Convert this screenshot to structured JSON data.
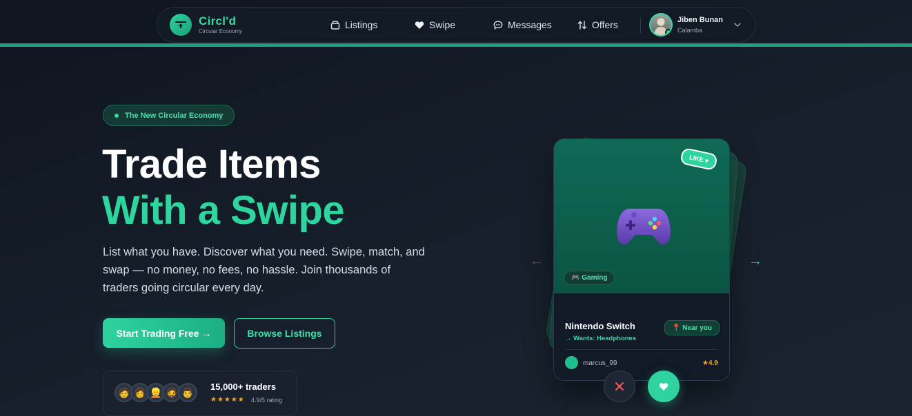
{
  "brand": {
    "name": "Circl'd",
    "tagline": "Circular Economy"
  },
  "nav": {
    "items": [
      {
        "label": "Listings",
        "icon": "box-icon"
      },
      {
        "label": "Swipe",
        "icon": "heart-icon"
      },
      {
        "label": "Messages",
        "icon": "chat-icon"
      },
      {
        "label": "Offers",
        "icon": "swap-icon"
      }
    ],
    "user": {
      "name": "Jiben Bunan",
      "location": "Calamba"
    }
  },
  "hero": {
    "badge": "The New Circular Economy",
    "title_line1": "Trade Items",
    "title_line2": "With a Swipe",
    "description": "List what you have. Discover what you need. Swipe, match, and swap — no money, no fees, no hassle. Join thousands of traders going circular every day.",
    "primary_cta": "Start Trading Free →",
    "secondary_cta": "Browse Listings",
    "social_proof": {
      "count": "15,000+ traders",
      "stars": "★★★★★",
      "rating": "4.9/5 rating",
      "faces": [
        "🧑",
        "👩",
        "👱",
        "🧔",
        "👨"
      ]
    }
  },
  "card": {
    "like_tag": "LIKE ♥",
    "category": "🎮 Gaming",
    "title": "Nintendo Switch",
    "wants": "→ Wants: Headphones",
    "distance": "📍 Near you",
    "seller": "marcus_99",
    "score": "★4.9",
    "prev_arrow": "←",
    "next_arrow": "→"
  },
  "colors": {
    "accent": "#2ed39f",
    "background": "#161f2b",
    "nav_bg": "#121a26",
    "card_image_bg": "#0f6a55",
    "star": "#f5a623"
  }
}
